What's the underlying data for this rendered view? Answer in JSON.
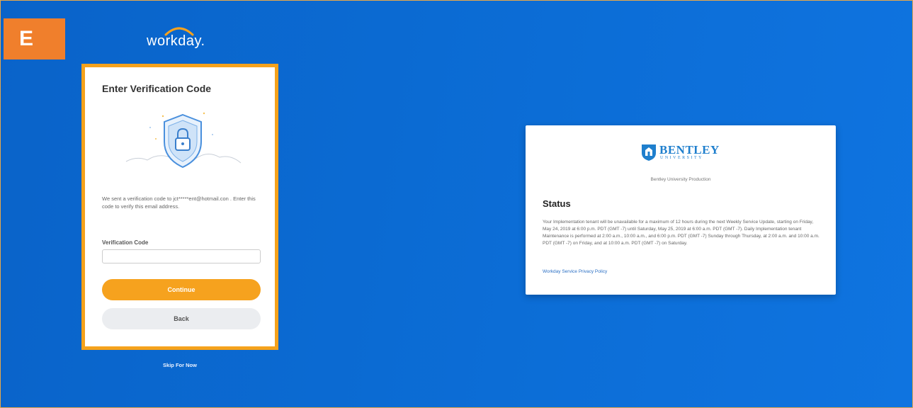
{
  "step_badge": "E",
  "logo": {
    "wordmark": "workday."
  },
  "login": {
    "title": "Enter Verification Code",
    "message": "We sent a verification code to jct*****ent@hotmail.con . Enter this code to verify this email address.",
    "code_label": "Verification Code",
    "code_value": "",
    "continue_label": "Continue",
    "back_label": "Back"
  },
  "skip_label": "Skip For Now",
  "status_card": {
    "logo_name": "BENTLEY",
    "logo_sub": "UNIVERSITY",
    "tenant": "Bentley University Production",
    "title": "Status",
    "body": "Your Implementation tenant will be unavailable for a maximum of 12 hours during the next Weekly Service Update, starting on Friday, May 24, 2019 at 6:00 p.m. PDT (GMT -7) until Saturday, May 25, 2019 at 6:00 a.m. PDT (GMT -7). Daily Implementation tenant Maintenance is performed at 2:00 a.m., 10:00 a.m., and 6:00 p.m. PDT (GMT -7) Sunday through Thursday, at 2:00 a.m. and 10:00 a.m. PDT (GMT -7) on Friday, and at 10:00 a.m. PDT (GMT -7) on Saturday.",
    "privacy_link": "Workday Service Privacy Policy"
  },
  "colors": {
    "background": "#0b6bd3",
    "accent_orange": "#f6a21e",
    "badge_orange": "#f07f2c",
    "bentley_blue": "#1f7fcd"
  },
  "icons": [
    "workday-logo-icon",
    "shield-lock-icon",
    "bentley-crest-icon"
  ]
}
